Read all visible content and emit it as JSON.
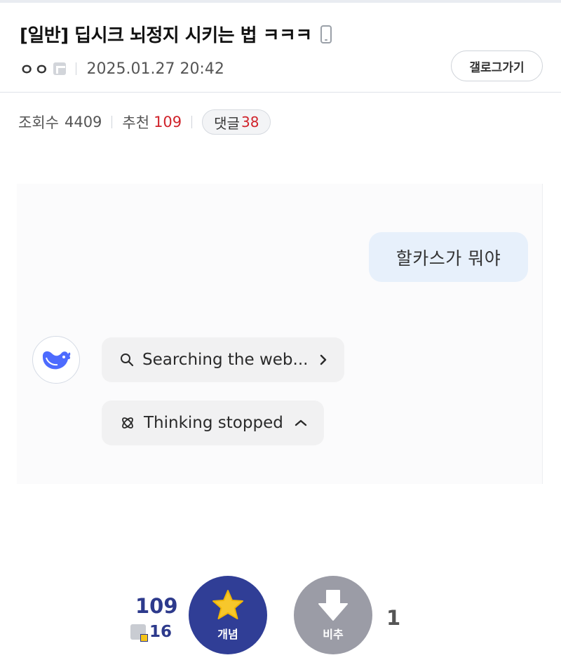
{
  "post": {
    "title": "[일반] 딥시크 뇌정지 시키는 법 ㅋㅋㅋ",
    "author": "ㅇㅇ",
    "date": "2025.01.27 20:42",
    "gallery_button": "갤로그가기",
    "icons": {
      "device": "mobile-phone-icon",
      "author_badge": "fixed-nick-icon"
    }
  },
  "stats": {
    "views_label": "조회수",
    "views": "4409",
    "recommend_label": "추천",
    "recommend": "109",
    "comments_label": "댓글",
    "comments": "38"
  },
  "screenshot": {
    "user_message": "할카스가 뭐야",
    "assistant_avatar": "deepseek-whale-icon",
    "search_chip": "Searching the web...",
    "thinking_chip": "Thinking stopped"
  },
  "vote": {
    "up_count": "109",
    "fixed_up_count": "16",
    "up_label": "개념",
    "down_label": "비추",
    "down_count": "1"
  },
  "colors": {
    "accent_blue": "#303e96",
    "red": "#d0232b",
    "down_gray": "#9b9ca6",
    "bubble_blue": "#e7f0fb"
  }
}
